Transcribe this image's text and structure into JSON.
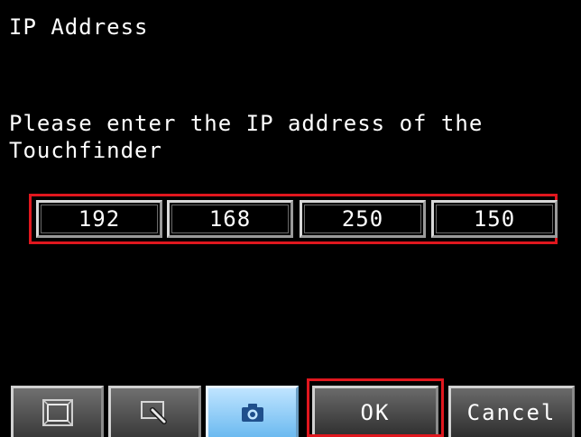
{
  "dialog": {
    "title": "IP Address",
    "prompt_line1": "Please enter the IP address of the",
    "prompt_line2": "Touchfinder"
  },
  "ip_address": {
    "octets": [
      "192",
      "168",
      "250",
      "150"
    ]
  },
  "toolbar": {
    "icons": [
      "frame-fit-icon",
      "zoom-select-icon",
      "camera-icon"
    ]
  },
  "buttons": {
    "ok_label": "OK",
    "cancel_label": "Cancel"
  },
  "colors": {
    "highlight": "#e0171e",
    "background": "#000000",
    "camera_button": "#6cbaf0"
  }
}
